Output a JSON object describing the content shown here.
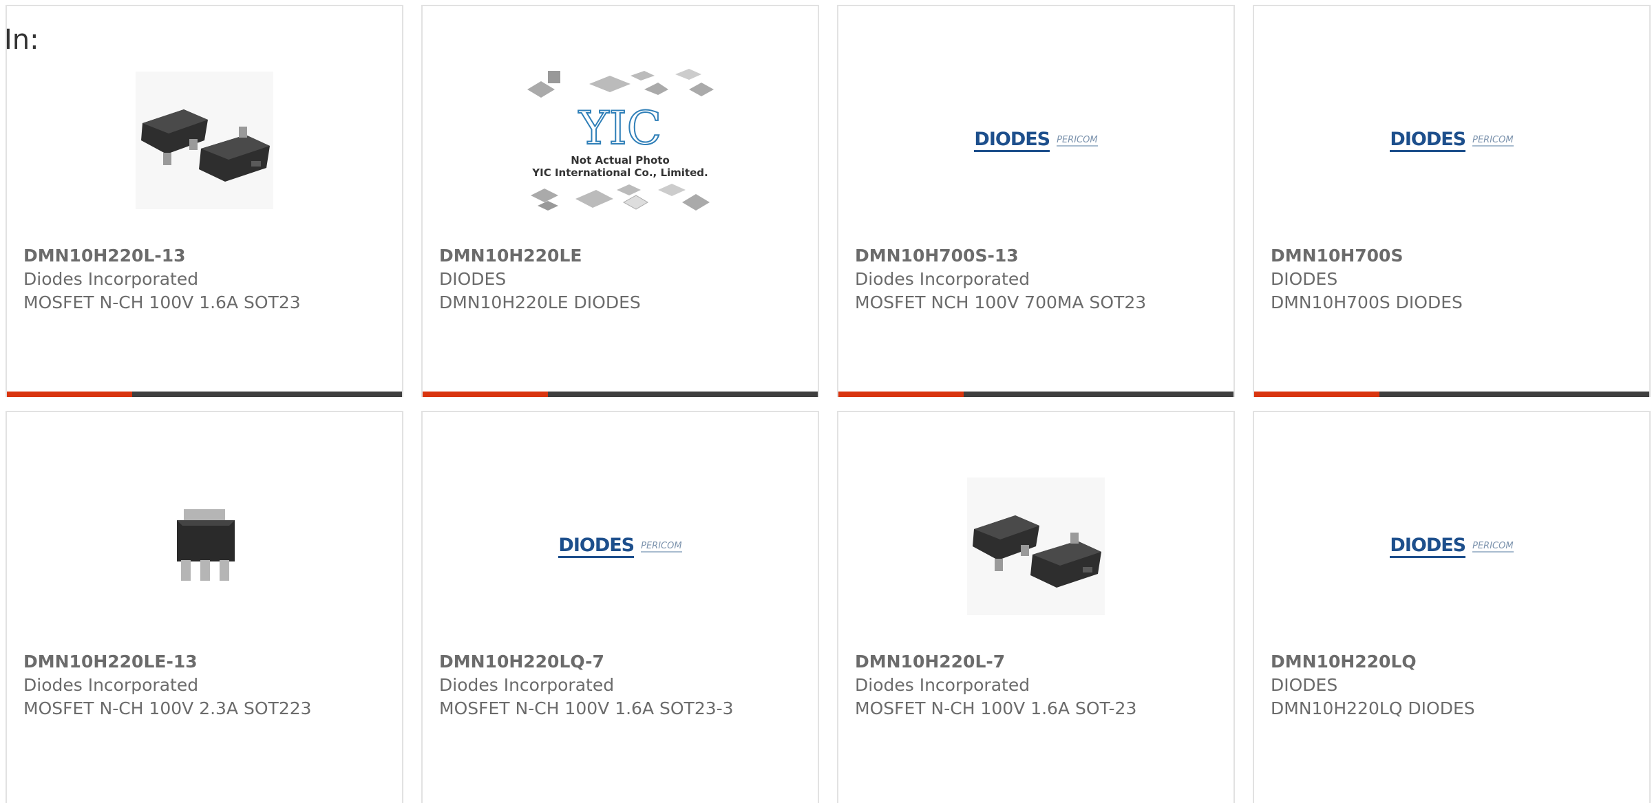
{
  "page": {
    "label": "In:"
  },
  "products": [
    {
      "part": "DMN10H220L-13",
      "maker": "Diodes Incorporated",
      "desc": "MOSFET N-CH 100V 1.6A SOT23",
      "image": "sot23-package-photo"
    },
    {
      "part": "DMN10H220LE",
      "maker": "DIODES",
      "desc": "DMN10H220LE DIODES",
      "image": "yic-not-actual-photo",
      "image_text": [
        "YIC",
        "Not Actual Photo",
        "YIC International Co., Limited."
      ]
    },
    {
      "part": "DMN10H700S-13",
      "maker": "Diodes Incorporated",
      "desc": "MOSFET NCH 100V 700MA SOT23",
      "image": "diodes-pericom-logo",
      "image_text": [
        "DIODES",
        "PERICOM"
      ]
    },
    {
      "part": "DMN10H700S",
      "maker": "DIODES",
      "desc": "DMN10H700S DIODES",
      "image": "diodes-pericom-logo",
      "image_text": [
        "DIODES",
        "PERICOM"
      ]
    },
    {
      "part": "DMN10H220LE-13",
      "maker": "Diodes Incorporated",
      "desc": "MOSFET N-CH 100V 2.3A SOT223",
      "image": "sot223-package-photo"
    },
    {
      "part": "DMN10H220LQ-7",
      "maker": "Diodes Incorporated",
      "desc": "MOSFET N-CH 100V 1.6A SOT23-3",
      "image": "diodes-pericom-logo",
      "image_text": [
        "DIODES",
        "PERICOM"
      ]
    },
    {
      "part": "DMN10H220L-7",
      "maker": "Diodes Incorporated",
      "desc": "MOSFET N-CH 100V 1.6A SOT-23",
      "image": "sot23-package-photo"
    },
    {
      "part": "DMN10H220LQ",
      "maker": "DIODES",
      "desc": "DMN10H220LQ DIODES",
      "image": "diodes-pericom-logo",
      "image_text": [
        "DIODES",
        "PERICOM"
      ]
    }
  ],
  "colors": {
    "accent": "#d9350f",
    "bar": "#3f3f3f",
    "border": "#e2e2e2",
    "text": "#6b6b6b",
    "brand": "#1d4f8c"
  }
}
